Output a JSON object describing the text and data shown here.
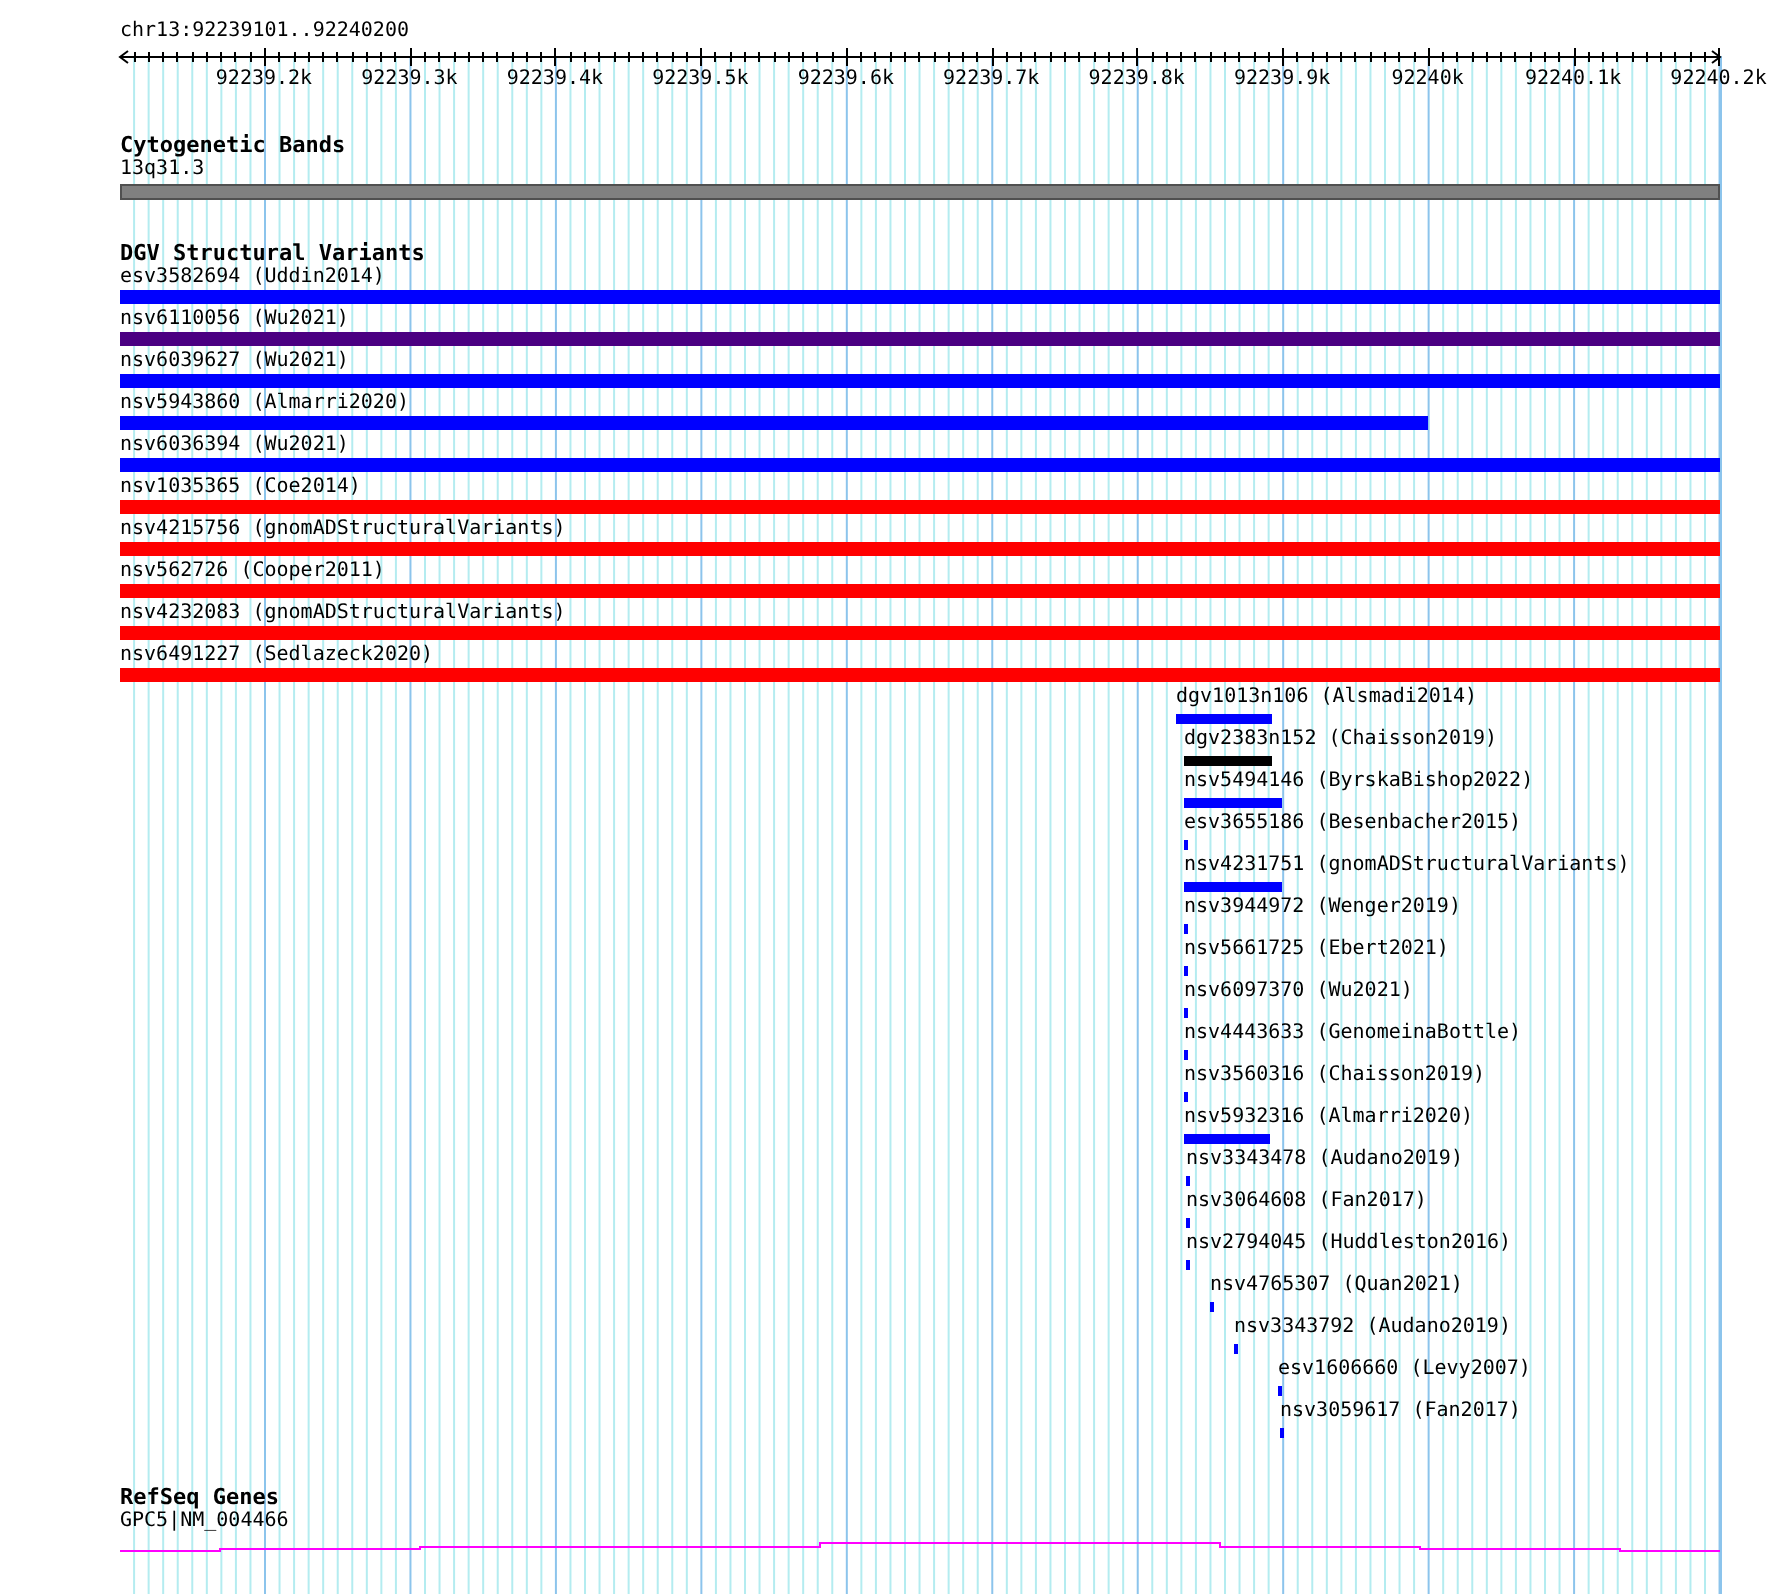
{
  "ruler": {
    "location": "chr13:92239101..92240200",
    "ticks": [
      "92239.2k",
      "92239.3k",
      "92239.4k",
      "92239.5k",
      "92239.6k",
      "92239.7k",
      "92239.8k",
      "92239.9k",
      "92240k",
      "92240.1k",
      "92240.2k"
    ]
  },
  "tracks": [
    {
      "kind": "cytoband",
      "title": "Cytogenetic Bands",
      "features": [
        {
          "label": "13q31.3",
          "color": "#808080"
        }
      ]
    },
    {
      "kind": "variants",
      "title": "DGV Structural Variants",
      "features": [
        {
          "label": "esv3582694 (Uddin2014)",
          "color": "#0000ff"
        },
        {
          "label": "nsv6110056 (Wu2021)",
          "color": "#4b0082"
        },
        {
          "label": "nsv6039627 (Wu2021)",
          "color": "#0000ff"
        },
        {
          "label": "nsv5943860 (Almarri2020)",
          "color": "#0000ff"
        },
        {
          "label": "nsv6036394 (Wu2021)",
          "color": "#0000ff"
        },
        {
          "label": "nsv1035365 (Coe2014)",
          "color": "#ff0000"
        },
        {
          "label": "nsv4215756 (gnomADStructuralVariants)",
          "color": "#ff0000"
        },
        {
          "label": "nsv562726 (Cooper2011)",
          "color": "#ff0000"
        },
        {
          "label": "nsv4232083 (gnomADStructuralVariants)",
          "color": "#ff0000"
        },
        {
          "label": "nsv6491227 (Sedlazeck2020)",
          "color": "#ff0000"
        },
        {
          "label": "dgv1013n106 (Alsmadi2014)",
          "color": "#0000ff"
        },
        {
          "label": "dgv2383n152 (Chaisson2019)",
          "color": "#000000"
        },
        {
          "label": "nsv5494146 (ByrskaBishop2022)",
          "color": "#0000ff"
        },
        {
          "label": "esv3655186 (Besenbacher2015)",
          "color": "#0000ff"
        },
        {
          "label": "nsv4231751 (gnomADStructuralVariants)",
          "color": "#0000ff"
        },
        {
          "label": "nsv3944972 (Wenger2019)",
          "color": "#0000ff"
        },
        {
          "label": "nsv5661725 (Ebert2021)",
          "color": "#0000ff"
        },
        {
          "label": "nsv6097370 (Wu2021)",
          "color": "#0000ff"
        },
        {
          "label": "nsv4443633 (GenomeinaBottle)",
          "color": "#0000ff"
        },
        {
          "label": "nsv3560316 (Chaisson2019)",
          "color": "#0000ff"
        },
        {
          "label": "nsv5932316 (Almarri2020)",
          "color": "#0000ff"
        },
        {
          "label": "nsv3343478 (Audano2019)",
          "color": "#0000ff"
        },
        {
          "label": "nsv3064608 (Fan2017)",
          "color": "#0000ff"
        },
        {
          "label": "nsv2794045 (Huddleston2016)",
          "color": "#0000ff"
        },
        {
          "label": "nsv4765307 (Quan2021)",
          "color": "#0000ff"
        },
        {
          "label": "nsv3343792 (Audano2019)",
          "color": "#0000ff"
        },
        {
          "label": "esv1606660 (Levy2007)",
          "color": "#0000ff"
        },
        {
          "label": "nsv3059617 (Fan2017)",
          "color": "#0000ff"
        }
      ]
    },
    {
      "kind": "gene",
      "title": "RefSeq Genes",
      "features": [
        {
          "label": "GPC5|NM_004466",
          "color": "#ff00ff"
        }
      ]
    }
  ]
}
